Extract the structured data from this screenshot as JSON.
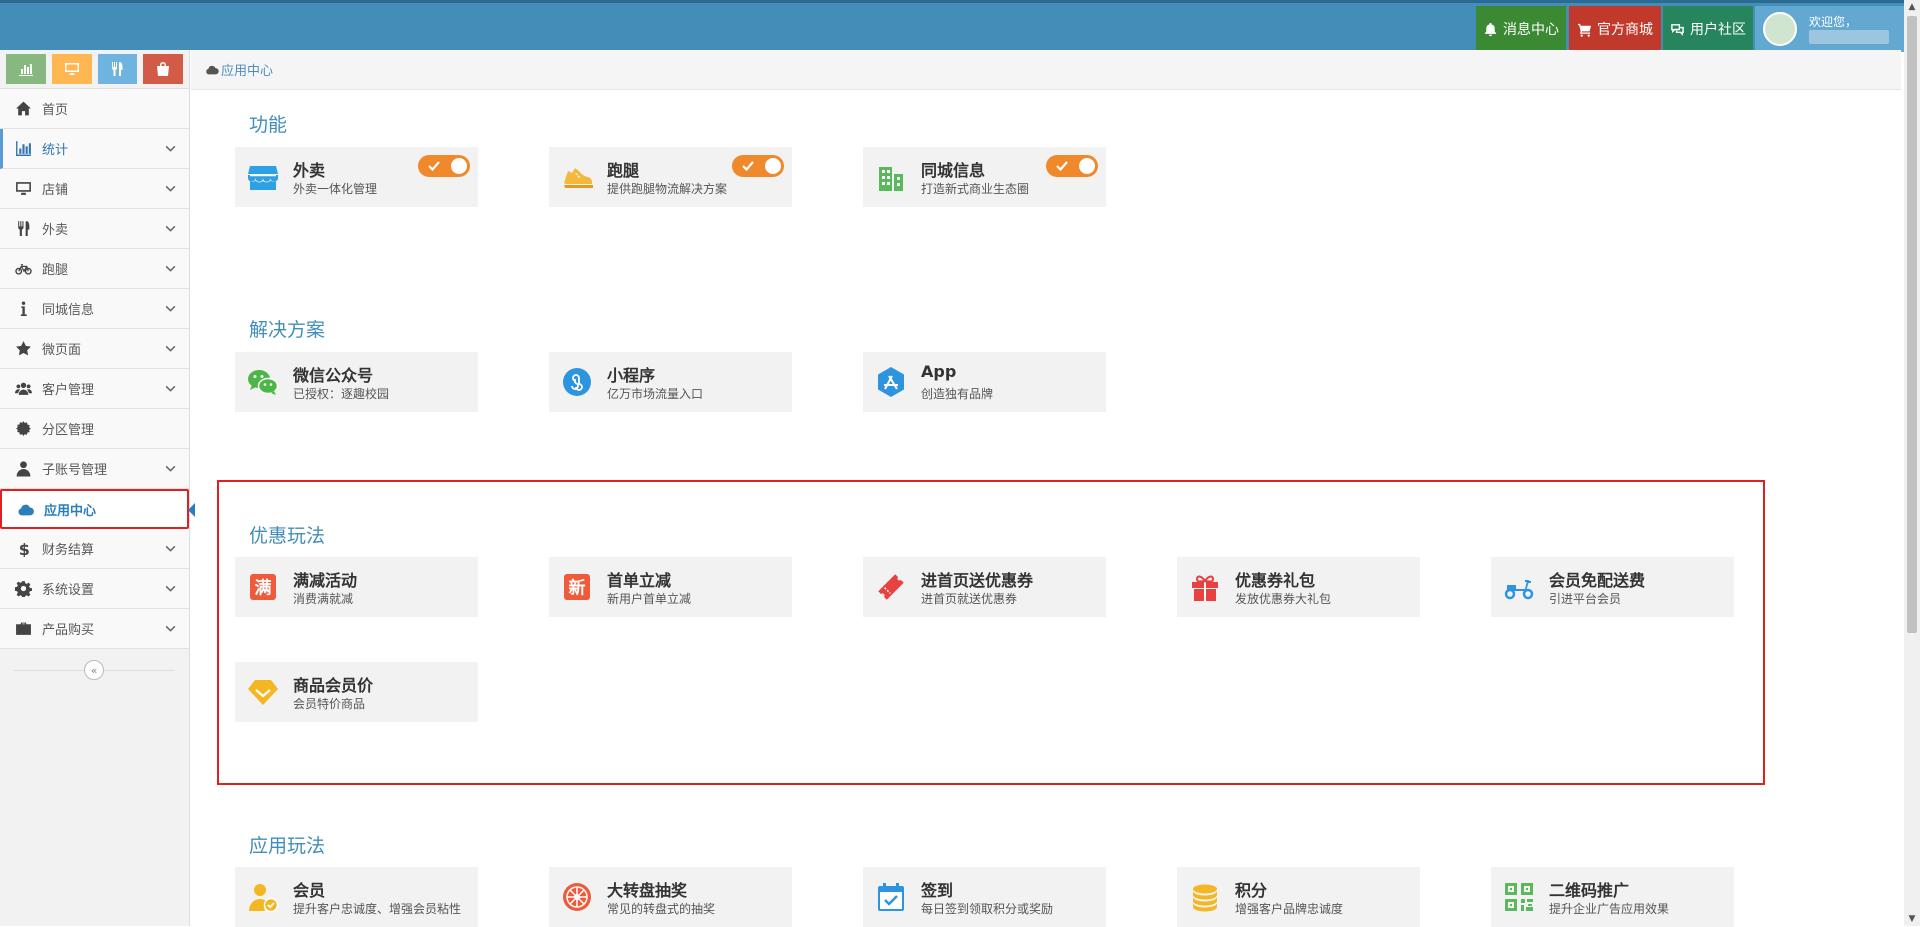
{
  "topbar": {
    "messages": "消息中心",
    "shop": "官方商城",
    "community": "用户社区",
    "welcome": "欢迎您，"
  },
  "colors": {
    "topbar": "#438eb9",
    "accent": "#438eb9",
    "toggle": "#f0892c",
    "highlight_border": "#e02020"
  },
  "shortcuts": [
    {
      "icon": "bar-chart-icon",
      "color": "#87b87f"
    },
    {
      "icon": "desktop-icon",
      "color": "#ffb752"
    },
    {
      "icon": "cutlery-icon",
      "color": "#6fb3e0"
    },
    {
      "icon": "shopping-bag-icon",
      "color": "#d15b47"
    }
  ],
  "sidebar": {
    "items": [
      {
        "label": "首页",
        "icon": "home-icon"
      },
      {
        "label": "统计",
        "icon": "bar-chart-icon"
      },
      {
        "label": "店铺",
        "icon": "desktop-icon"
      },
      {
        "label": "外卖",
        "icon": "cutlery-icon"
      },
      {
        "label": "跑腿",
        "icon": "bicycle-icon"
      },
      {
        "label": "同城信息",
        "icon": "info-icon"
      },
      {
        "label": "微页面",
        "icon": "star-icon"
      },
      {
        "label": "客户管理",
        "icon": "users-icon"
      },
      {
        "label": "分区管理",
        "icon": "gear-icon"
      },
      {
        "label": "子账号管理",
        "icon": "user-icon"
      },
      {
        "label": "应用中心",
        "icon": "cloud-icon"
      },
      {
        "label": "财务结算",
        "icon": "dollar-icon"
      },
      {
        "label": "系统设置",
        "icon": "cog-icon"
      },
      {
        "label": "产品购买",
        "icon": "briefcase-icon"
      }
    ],
    "collapse": "«"
  },
  "breadcrumb": {
    "label": "应用中心"
  },
  "sections": {
    "features": {
      "title": "功能",
      "cards": [
        {
          "title": "外卖",
          "desc": "外卖一体化管理",
          "icon": "storefront-icon",
          "enabled": true
        },
        {
          "title": "跑腿",
          "desc": "提供跑腿物流解决方案",
          "icon": "running-shoe-icon",
          "enabled": true
        },
        {
          "title": "同城信息",
          "desc": "打造新式商业生态圈",
          "icon": "city-buildings-icon",
          "enabled": true
        }
      ]
    },
    "solutions": {
      "title": "解决方案",
      "cards": [
        {
          "title": "微信公众号",
          "desc": "已授权：逐趣校园",
          "icon": "wechat-icon"
        },
        {
          "title": "小程序",
          "desc": "亿万市场流量入口",
          "icon": "mini-program-icon"
        },
        {
          "title": "App",
          "desc": "创造独有品牌",
          "icon": "app-store-icon"
        }
      ]
    },
    "promotions": {
      "title": "优惠玩法",
      "cards": [
        {
          "title": "满减活动",
          "desc": "消费满就减",
          "icon": "full-reduction-icon",
          "glyph": "满"
        },
        {
          "title": "首单立减",
          "desc": "新用户首单立减",
          "icon": "first-order-icon",
          "glyph": "新"
        },
        {
          "title": "进首页送优惠券",
          "desc": "进首页就送优惠券",
          "icon": "coupon-ticket-icon"
        },
        {
          "title": "优惠券礼包",
          "desc": "发放优惠券大礼包",
          "icon": "gift-icon"
        },
        {
          "title": "会员免配送费",
          "desc": "引进平台会员",
          "icon": "scooter-icon"
        },
        {
          "title": "商品会员价",
          "desc": "会员特价商品",
          "icon": "diamond-icon"
        }
      ]
    },
    "apps": {
      "title": "应用玩法",
      "cards": [
        {
          "title": "会员",
          "desc": "提升客户忠诚度、增强会员粘性",
          "icon": "member-icon"
        },
        {
          "title": "大转盘抽奖",
          "desc": "常见的转盘式的抽奖",
          "icon": "wheel-icon"
        },
        {
          "title": "签到",
          "desc": "每日签到领取积分或奖励",
          "icon": "calendar-check-icon"
        },
        {
          "title": "积分",
          "desc": "增强客户品牌忠诚度",
          "icon": "coins-icon"
        },
        {
          "title": "二维码推广",
          "desc": "提升企业广告应用效果",
          "icon": "qr-code-icon"
        }
      ]
    }
  }
}
